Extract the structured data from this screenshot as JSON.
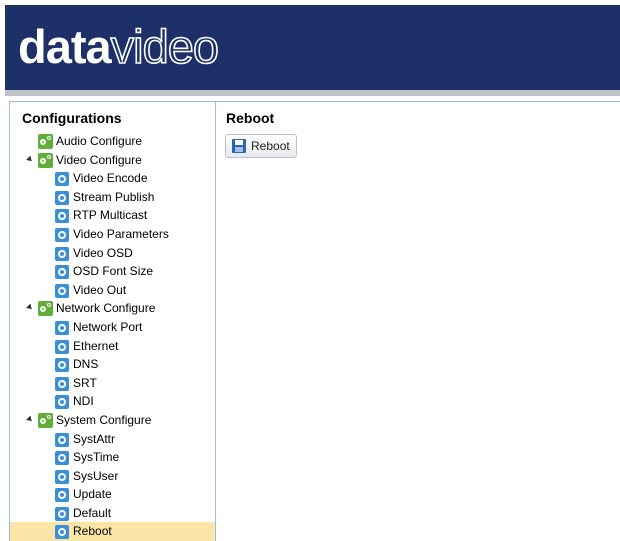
{
  "header": {
    "logo_bold": "data",
    "logo_outline": "video",
    "background_color": "#1d3168"
  },
  "sidebar": {
    "title": "Configurations",
    "tree": [
      {
        "label": "Audio Configure",
        "type": "group",
        "level": 0,
        "expandable": false
      },
      {
        "label": "Video Configure",
        "type": "group",
        "level": 0,
        "expandable": true
      },
      {
        "label": "Video Encode",
        "type": "leaf",
        "level": 1
      },
      {
        "label": "Stream Publish",
        "type": "leaf",
        "level": 1
      },
      {
        "label": "RTP Multicast",
        "type": "leaf",
        "level": 1
      },
      {
        "label": "Video Parameters",
        "type": "leaf",
        "level": 1
      },
      {
        "label": "Video OSD",
        "type": "leaf",
        "level": 1
      },
      {
        "label": "OSD Font Size",
        "type": "leaf",
        "level": 1
      },
      {
        "label": "Video Out",
        "type": "leaf",
        "level": 1
      },
      {
        "label": "Network Configure",
        "type": "group",
        "level": 0,
        "expandable": true
      },
      {
        "label": "Network Port",
        "type": "leaf",
        "level": 1
      },
      {
        "label": "Ethernet",
        "type": "leaf",
        "level": 1
      },
      {
        "label": "DNS",
        "type": "leaf",
        "level": 1
      },
      {
        "label": "SRT",
        "type": "leaf",
        "level": 1
      },
      {
        "label": "NDI",
        "type": "leaf",
        "level": 1
      },
      {
        "label": "System Configure",
        "type": "group",
        "level": 0,
        "expandable": true
      },
      {
        "label": "SystAttr",
        "type": "leaf",
        "level": 1
      },
      {
        "label": "SysTime",
        "type": "leaf",
        "level": 1
      },
      {
        "label": "SysUser",
        "type": "leaf",
        "level": 1
      },
      {
        "label": "Update",
        "type": "leaf",
        "level": 1
      },
      {
        "label": "Default",
        "type": "leaf",
        "level": 1
      },
      {
        "label": "Reboot",
        "type": "leaf",
        "level": 1,
        "selected": true
      }
    ],
    "selected_color": "#fbe5a6"
  },
  "main": {
    "title": "Reboot",
    "reboot_button_label": "Reboot"
  }
}
